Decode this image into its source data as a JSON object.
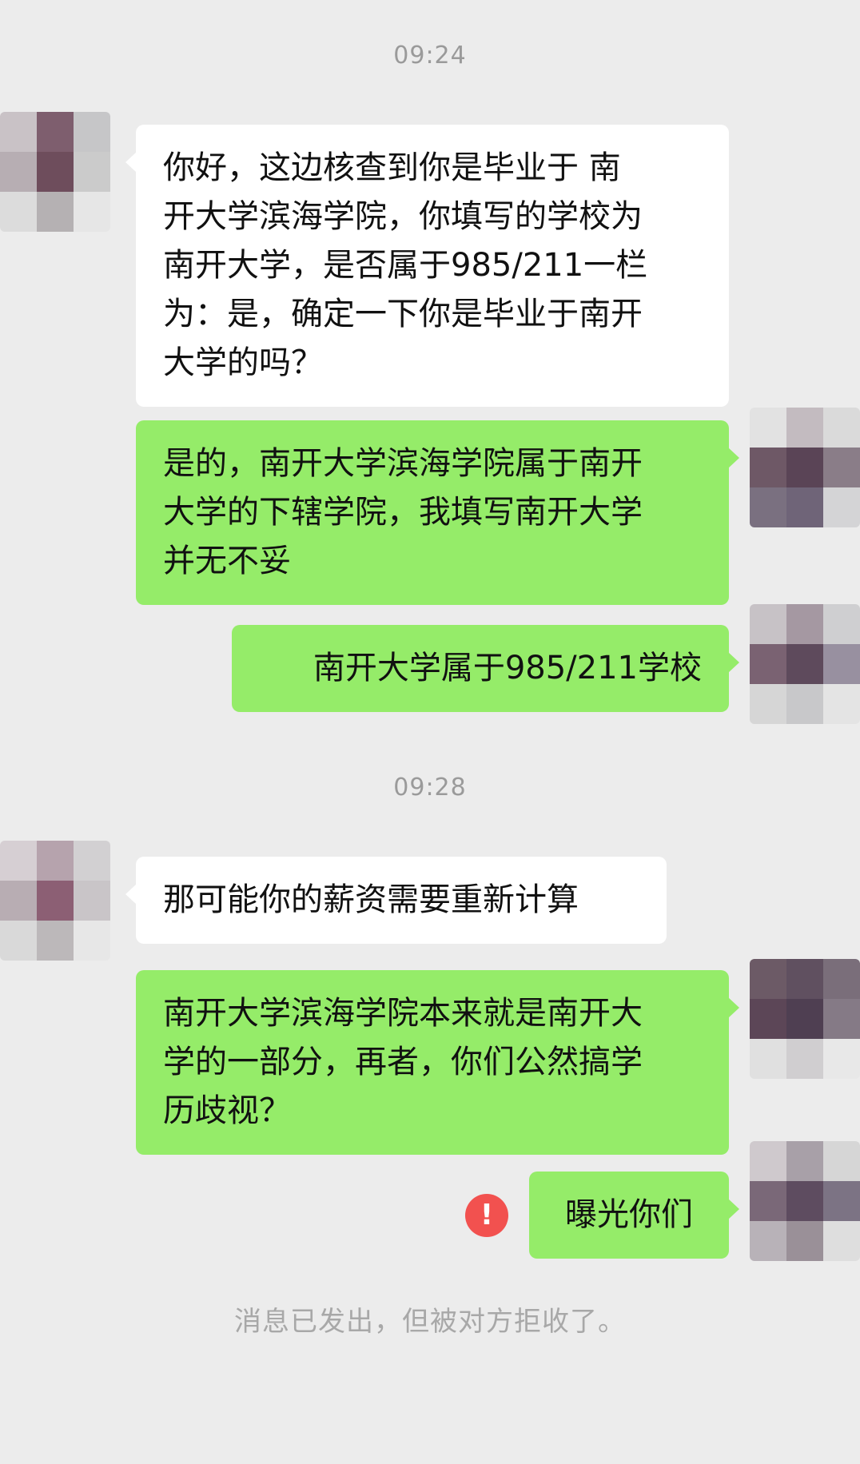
{
  "chat": {
    "timestamps": [
      "09:24",
      "09:28"
    ],
    "messages": [
      {
        "sender": "other",
        "lines": [
          "你好，这边核查到你是毕业于 南",
          "开大学滨海学院，你填写的学校为",
          "南开大学，是否属于985/211一栏",
          "为：是，确定一下你是毕业于南开",
          "大学的吗？"
        ]
      },
      {
        "sender": "me",
        "lines": [
          "是的，南开大学滨海学院属于南开",
          "大学的下辖学院，我填写南开大学",
          "并无不妥"
        ]
      },
      {
        "sender": "me",
        "lines": [
          "南开大学属于985/211学校"
        ]
      },
      {
        "sender": "other",
        "lines": [
          "那可能你的薪资需要重新计算"
        ]
      },
      {
        "sender": "me",
        "lines": [
          "南开大学滨海学院本来就是南开大",
          "学的一部分，再者，你们公然搞学",
          "历歧视？"
        ]
      },
      {
        "sender": "me",
        "lines": [
          "曝光你们"
        ],
        "status_icon": "!"
      }
    ],
    "system_notice": "消息已发出，但被对方拒收了。"
  },
  "colors": {
    "background": "#ececec",
    "incoming_bubble": "#ffffff",
    "outgoing_bubble": "#95ec69",
    "error_badge": "#f2514f",
    "timestamp_text": "#9a9a9a"
  },
  "icons": {
    "avatar": "pixelated-avatar",
    "send_failed": "exclamation-circle-icon"
  }
}
